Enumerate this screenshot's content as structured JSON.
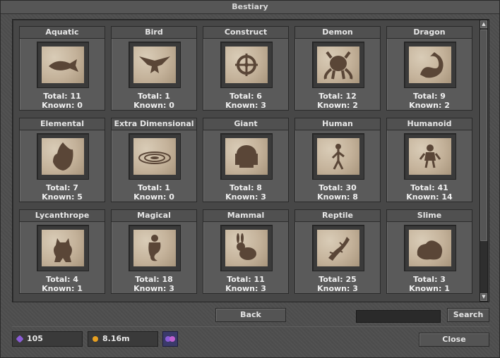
{
  "window": {
    "title": "Bestiary"
  },
  "categories": [
    {
      "name": "Aquatic",
      "total": "Total: 11",
      "known": "Known: 0",
      "icon": "fish-icon"
    },
    {
      "name": "Bird",
      "total": "Total: 1",
      "known": "Known: 0",
      "icon": "bird-icon"
    },
    {
      "name": "Construct",
      "total": "Total: 6",
      "known": "Known: 3",
      "icon": "gear-icon"
    },
    {
      "name": "Demon",
      "total": "Total: 12",
      "known": "Known: 2",
      "icon": "demon-icon"
    },
    {
      "name": "Dragon",
      "total": "Total: 9",
      "known": "Known: 2",
      "icon": "dragon-icon"
    },
    {
      "name": "Elemental",
      "total": "Total: 7",
      "known": "Known: 5",
      "icon": "flame-icon"
    },
    {
      "name": "Extra Dimensional",
      "total": "Total: 1",
      "known": "Known: 0",
      "icon": "vortex-icon"
    },
    {
      "name": "Giant",
      "total": "Total: 8",
      "known": "Known: 3",
      "icon": "giant-icon"
    },
    {
      "name": "Human",
      "total": "Total: 30",
      "known": "Known: 8",
      "icon": "human-icon"
    },
    {
      "name": "Humanoid",
      "total": "Total: 41",
      "known": "Known: 14",
      "icon": "humanoid-icon"
    },
    {
      "name": "Lycanthrope",
      "total": "Total: 4",
      "known": "Known: 1",
      "icon": "werewolf-icon"
    },
    {
      "name": "Magical",
      "total": "Total: 18",
      "known": "Known: 3",
      "icon": "genie-icon"
    },
    {
      "name": "Mammal",
      "total": "Total: 11",
      "known": "Known: 3",
      "icon": "rabbit-icon"
    },
    {
      "name": "Reptile",
      "total": "Total: 25",
      "known": "Known: 3",
      "icon": "lizard-icon"
    },
    {
      "name": "Slime",
      "total": "Total: 3",
      "known": "Known: 1",
      "icon": "slime-icon"
    }
  ],
  "buttons": {
    "back": "Back",
    "search": "Search",
    "close": "Close"
  },
  "search": {
    "value": ""
  },
  "currency": {
    "points": {
      "value": "105",
      "icon": "purple-gem-icon",
      "color": "#8a5cd6"
    },
    "gold": {
      "value": "8.16m",
      "icon": "gold-coin-icon",
      "color": "#e8a020"
    },
    "store_button_icon": "store-icon"
  },
  "colors": {
    "parchment": "#c9b9a2",
    "silhouette": "#5a4637",
    "panel": "#4e4e4e"
  }
}
